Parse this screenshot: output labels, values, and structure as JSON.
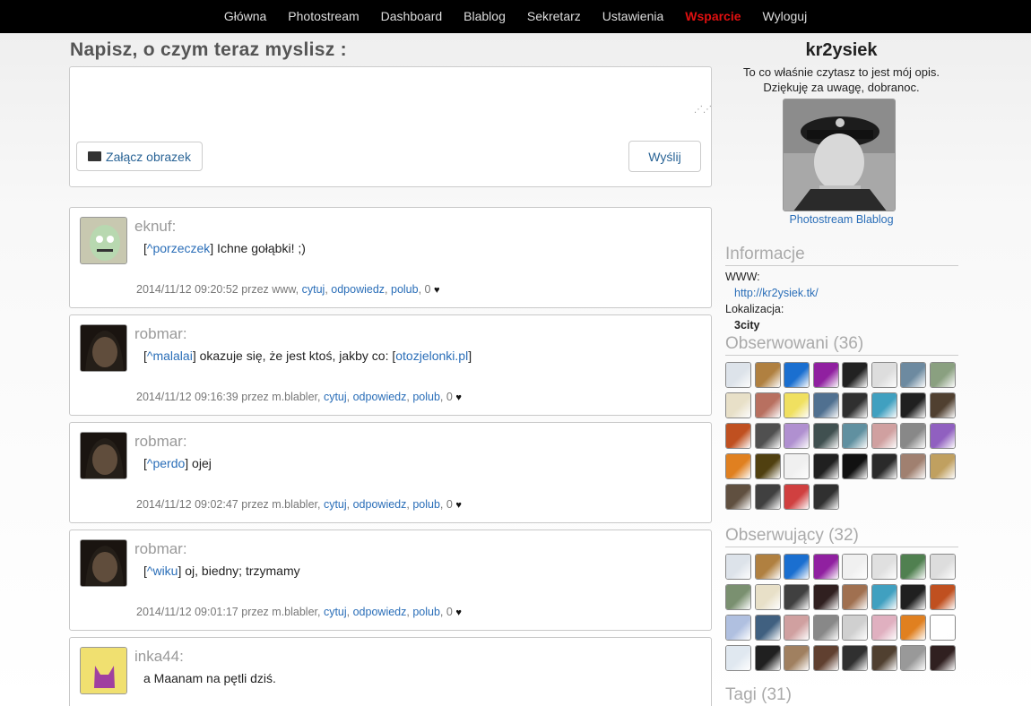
{
  "nav": {
    "items": [
      "Główna",
      "Photostream",
      "Dashboard",
      "Blablog",
      "Sekretarz",
      "Ustawienia",
      "Wsparcie",
      "Wyloguj"
    ],
    "active_color": "#e01010"
  },
  "compose": {
    "title": "Napisz, o czym teraz myslisz :",
    "placeholder": "",
    "attach_label": "Załącz obrazek",
    "send_label": "Wyślij"
  },
  "posts": [
    {
      "author": "eknuf:",
      "reply_to": "^porzeczek",
      "text": " Ichne gołąbki! ;)",
      "date": "2014/11/12 09:20:52 przez www,",
      "actions": [
        "cytuj",
        "odpowiedz",
        "polub"
      ],
      "likes": "0",
      "avatar_color": "#9aab8a"
    },
    {
      "author": "robmar:",
      "reply_to": "^malalai",
      "text": " okazuje się, że jest ktoś, jakby co: ",
      "link2": "otozjelonki.pl",
      "date": "2014/11/12 09:16:39 przez m.blabler,",
      "actions": [
        "cytuj",
        "odpowiedz",
        "polub"
      ],
      "likes": "0",
      "avatar_color": "#3a3028"
    },
    {
      "author": "robmar:",
      "reply_to": "^perdo",
      "text": " ojej",
      "date": "2014/11/12 09:02:47 przez m.blabler,",
      "actions": [
        "cytuj",
        "odpowiedz",
        "polub"
      ],
      "likes": "0",
      "avatar_color": "#3a3028"
    },
    {
      "author": "robmar:",
      "reply_to": "^wiku",
      "text": " oj, biedny; trzymamy",
      "date": "2014/11/12 09:01:17 przez m.blabler,",
      "actions": [
        "cytuj",
        "odpowiedz",
        "polub"
      ],
      "likes": "0",
      "avatar_color": "#3a3028"
    },
    {
      "author": "inka44:",
      "text": "a Maanam na pętli dziś.",
      "avatar_color": "#e8d070"
    }
  ],
  "profile": {
    "name": "kr2ysiek",
    "desc_line1": "To co właśnie czytasz to jest mój opis.",
    "desc_line2": "Dziękuję za uwagę, dobranoc.",
    "link_photostream": "Photostream",
    "link_blablog": "Blablog"
  },
  "info": {
    "title": "Informacje",
    "www_label": "WWW:",
    "www_value": "http://kr2ysiek.tk/",
    "location_label": "Lokalizacja:",
    "location_value": "3city"
  },
  "following": {
    "title": "Obserwowani (36)",
    "colors": [
      "#dde3ea",
      "#b08040",
      "#1a6fd0",
      "#9020a0",
      "#222222",
      "#dddddd",
      "#6d8aa0",
      "#8aa080",
      "#e8e0c8",
      "#b87060",
      "#f0e060",
      "#507090",
      "#303030",
      "#40a0c0",
      "#202020",
      "#504030",
      "#c05020",
      "#505050",
      "#b090d0",
      "#405050",
      "#6090a0",
      "#d0a0a0",
      "#888888",
      "#9060c0",
      "#e08020",
      "#504010",
      "#f0f0f0",
      "#202020",
      "#111111",
      "#2a2a2a",
      "#a08070",
      "#c0a060",
      "#605040",
      "#404040",
      "#d04040",
      "#303030"
    ]
  },
  "followers": {
    "title": "Obserwujący (32)",
    "colors": [
      "#dde3ea",
      "#b08040",
      "#1a6fd0",
      "#9020a0",
      "#f0f0f0",
      "#e0e0e0",
      "#508050",
      "#dddddd",
      "#7a9070",
      "#e8e0c8",
      "#404040",
      "#302020",
      "#a07050",
      "#40a0c0",
      "#202020",
      "#c05020",
      "#b0c0e0",
      "#406080",
      "#d0a0a0",
      "#888888",
      "#d0d0d0",
      "#e0b0c0",
      "#e08020",
      "#ffffff",
      "#e0e8f0",
      "#202020",
      "#a08060",
      "#604030",
      "#303030",
      "#504030",
      "#999999",
      "#302020"
    ]
  },
  "tags": {
    "title": "Tagi (31)"
  }
}
